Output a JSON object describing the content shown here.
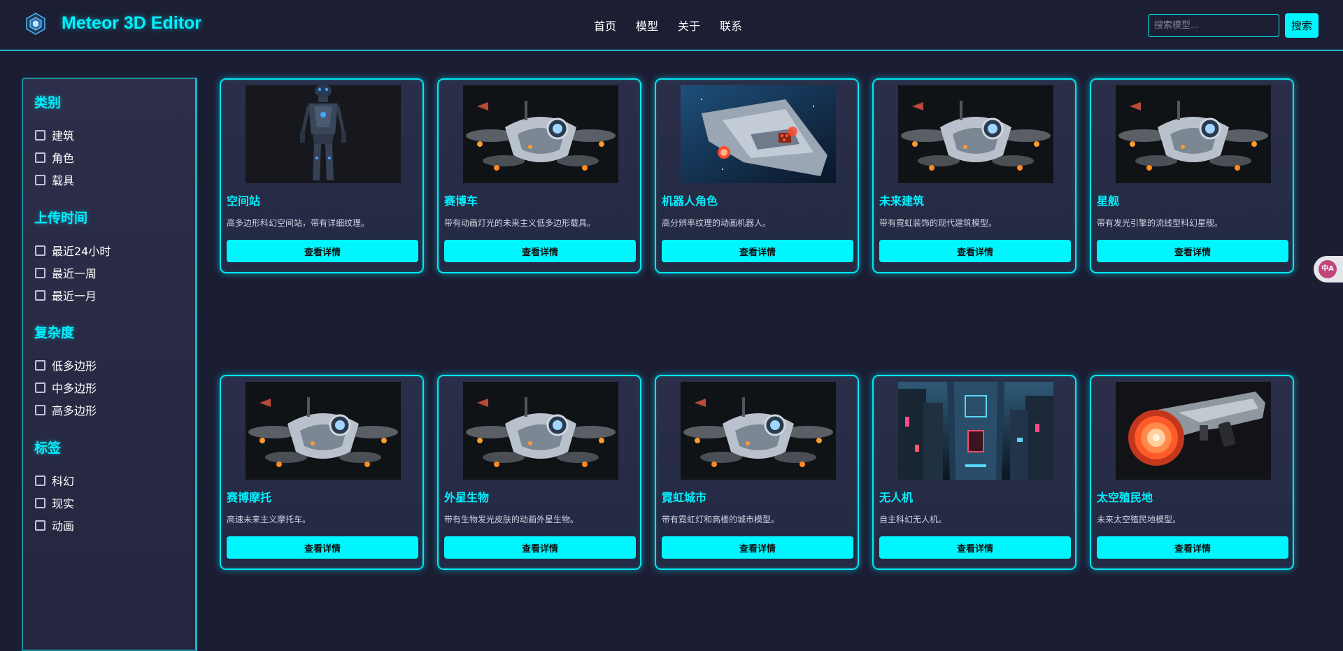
{
  "header": {
    "app_title": "Meteor 3D Editor",
    "logo_icon": "cube-logo-icon",
    "nav": [
      "首页",
      "模型",
      "关于",
      "联系"
    ],
    "search_placeholder": "搜索模型...",
    "search_button": "搜索"
  },
  "sidebar": {
    "groups": [
      {
        "title": "类别",
        "options": [
          "建筑",
          "角色",
          "载具"
        ]
      },
      {
        "title": "上传时间",
        "options": [
          "最近24小时",
          "最近一周",
          "最近一月"
        ]
      },
      {
        "title": "复杂度",
        "options": [
          "低多边形",
          "中多边形",
          "高多边形"
        ]
      },
      {
        "title": "标签",
        "options": [
          "科幻",
          "现实",
          "动画"
        ]
      }
    ]
  },
  "cards": [
    {
      "title": "空间站",
      "desc": "高多边形科幻空间站，带有详细纹理。",
      "button": "查看详情",
      "thumb": "robot"
    },
    {
      "title": "赛博车",
      "desc": "带有动画灯光的未来主义低多边形载具。",
      "button": "查看详情",
      "thumb": "drone"
    },
    {
      "title": "机器人角色",
      "desc": "高分辨率纹理的动画机器人。",
      "button": "查看详情",
      "thumb": "ship"
    },
    {
      "title": "未来建筑",
      "desc": "带有霓虹装饰的现代建筑模型。",
      "button": "查看详情",
      "thumb": "drone"
    },
    {
      "title": "星舰",
      "desc": "带有发光引擎的流线型科幻星舰。",
      "button": "查看详情",
      "thumb": "drone"
    },
    {
      "title": "赛博摩托",
      "desc": "高速未来主义摩托车。",
      "button": "查看详情",
      "thumb": "drone"
    },
    {
      "title": "外星生物",
      "desc": "带有生物发光皮肤的动画外星生物。",
      "button": "查看详情",
      "thumb": "drone"
    },
    {
      "title": "霓虹城市",
      "desc": "带有霓虹灯和高楼的城市模型。",
      "button": "查看详情",
      "thumb": "drone"
    },
    {
      "title": "无人机",
      "desc": "自主科幻无人机。",
      "button": "查看详情",
      "thumb": "city"
    },
    {
      "title": "太空殖民地",
      "desc": "未来太空殖民地模型。",
      "button": "查看详情",
      "thumb": "gun"
    }
  ],
  "translate_widget": {
    "icon": "translate-icon",
    "label": "中A"
  },
  "colors": {
    "accent": "#00f6ff",
    "background": "#1b1d33",
    "text": "#ffffff"
  }
}
